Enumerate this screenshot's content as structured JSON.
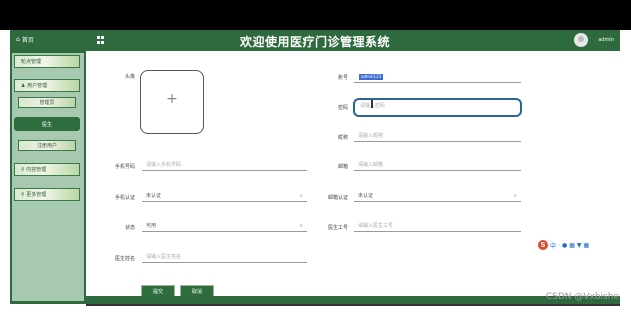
{
  "header": {
    "home": "首页",
    "title": "欢迎使用医疗门诊管理系统",
    "user": "admin"
  },
  "sidebar": {
    "items": [
      {
        "label": "轮点管理"
      },
      {
        "label": "用户管理"
      },
      {
        "label": "管理员"
      },
      {
        "label": "医生"
      },
      {
        "label": "注册用户"
      },
      {
        "label": "内容管理"
      },
      {
        "label": "更多管理"
      }
    ]
  },
  "form": {
    "avatar_label": "头像",
    "account_label": "账号",
    "account_value": "admin123",
    "password_label": "密码",
    "password_placeholder": "请输入密码",
    "nickname_label": "昵称",
    "nickname_placeholder": "请输入昵称",
    "phone_label": "手机号码",
    "phone_placeholder": "请输入手机号码",
    "email_label": "邮箱",
    "email_placeholder": "请输入邮箱",
    "phone_verify_label": "手机认证",
    "phone_verify_value": "未认证",
    "email_verify_label": "邮箱认证",
    "email_verify_value": "未认证",
    "status_label": "状态",
    "status_value": "可用",
    "doctor_no_label": "医生工号",
    "doctor_no_placeholder": "请输入医生工号",
    "doctor_name_label": "医生姓名",
    "doctor_name_placeholder": "请输入医生姓名",
    "submit": "提交",
    "cancel": "取消"
  },
  "watermark": "CSDN @Vxbishe",
  "ime_text": "中"
}
